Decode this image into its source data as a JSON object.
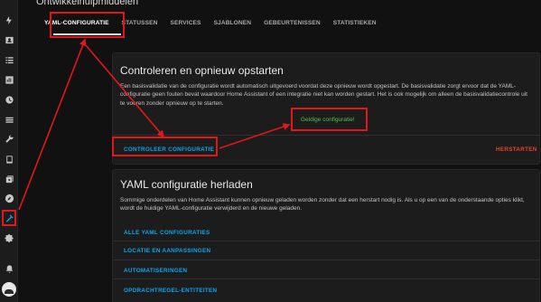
{
  "page": {
    "title": "Ontwikkelhulpmiddelen"
  },
  "tabs": [
    {
      "label": "YAML-CONFIGURATIE"
    },
    {
      "label": "STATUSSEN"
    },
    {
      "label": "SERVICES"
    },
    {
      "label": "SJABLONEN"
    },
    {
      "label": "GEBEURTENISSEN"
    },
    {
      "label": "STATISTIEKEN"
    }
  ],
  "check_card": {
    "title": "Controleren en opnieuw opstarten",
    "description": "Een basisvalidatie van de configuratie wordt automatisch uitgevoerd voordat deze opnieuw wordt opgestart. De basisvalidatie zorgt ervoor dat de YAML-configuratie geen fouten bevat waardoor Home Assistant of een integratie niet kan worden gestart. Het is ook mogelijk om alleen de basisvalidatiecontrole uit te voeren zonder opnieuw op te starten.",
    "valid_message": "Geldige configuratie!",
    "check_button": "CONTROLEER CONFIGURATIE",
    "restart_button": "HERSTARTEN"
  },
  "reload_card": {
    "title": "YAML configuratie herladen",
    "description": "Sommige onderdelen van Home Assistant kunnen opnieuw geladen worden zonder dat een herstart nodig is. Als u op een van de onderstaande opties klikt, wordt de huidige YAML-configuratie verwijderd en de nieuwe geladen.",
    "options": [
      {
        "label": "ALLE YAML CONFIGURATIES"
      },
      {
        "label": "LOCATIE EN AANPASSINGEN"
      },
      {
        "label": "AUTOMATISERINGEN"
      },
      {
        "label": "OPDRACHTREGEL-ENTITEITEN"
      }
    ]
  },
  "colors": {
    "accent": "#03a9f4",
    "annotation": "#e21818",
    "success": "#51c151",
    "danger": "#e8422f"
  },
  "sidebar_icons": [
    "bolt-icon",
    "person-card-icon",
    "list-icon",
    "chart-icon",
    "history-icon",
    "map-icon",
    "layers-icon",
    "wrench-icon",
    "tablet-icon",
    "media-icon",
    "compass-icon",
    "hammer-icon",
    "gear-icon",
    "bell-icon",
    "avatar"
  ]
}
